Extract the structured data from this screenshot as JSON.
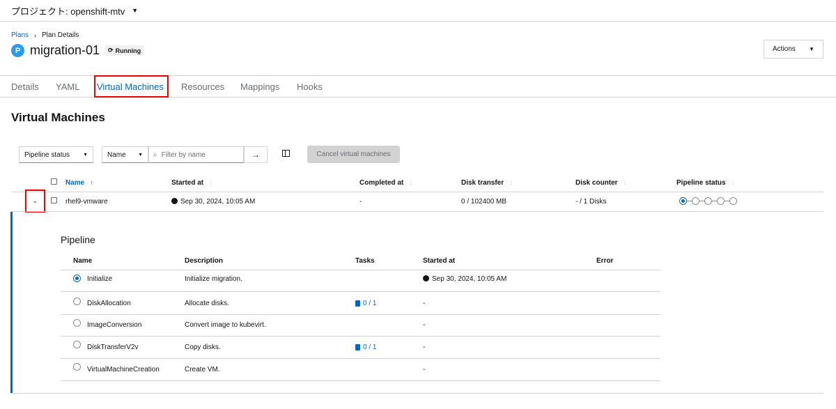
{
  "project": {
    "label": "プロジェクト: openshift-mtv"
  },
  "breadcrumb": {
    "plans": "Plans",
    "current": "Plan Details"
  },
  "header": {
    "badge": "P",
    "title": "migration-01",
    "status": "Running",
    "actions": "Actions"
  },
  "tabs": [
    {
      "label": "Details"
    },
    {
      "label": "YAML"
    },
    {
      "label": "Virtual Machines"
    },
    {
      "label": "Resources"
    },
    {
      "label": "Mappings"
    },
    {
      "label": "Hooks"
    }
  ],
  "section_title": "Virtual Machines",
  "toolbar": {
    "pipeline_filter": "Pipeline status",
    "name_filter": "Name",
    "search_placeholder": "Filter by name",
    "cancel_button": "Cancel virtual machines"
  },
  "table": {
    "columns": [
      "Name",
      "Started at",
      "Completed at",
      "Disk transfer",
      "Disk counter",
      "Pipeline status"
    ],
    "rows": [
      {
        "name": "rhel9-vmware",
        "started": "Sep 30, 2024, 10:05 AM",
        "completed": "-",
        "disk_transfer": "0 / 102400 MB",
        "disk_counter": "- / 1 Disks"
      }
    ]
  },
  "pipeline": {
    "title": "Pipeline",
    "columns": [
      "Name",
      "Description",
      "Tasks",
      "Started at",
      "Error"
    ],
    "steps": [
      {
        "name": "Initialize",
        "description": "Initialize migration.",
        "tasks": "",
        "started": "Sep 30, 2024, 10:05 AM"
      },
      {
        "name": "DiskAllocation",
        "description": "Allocate disks.",
        "tasks": "0 / 1",
        "started": "-"
      },
      {
        "name": "ImageConversion",
        "description": "Convert image to kubevirt.",
        "tasks": "",
        "started": "-"
      },
      {
        "name": "DiskTransferV2v",
        "description": "Copy disks.",
        "tasks": "0 / 1",
        "started": "-"
      },
      {
        "name": "VirtualMachineCreation",
        "description": "Create VM.",
        "tasks": "",
        "started": "-"
      }
    ]
  }
}
